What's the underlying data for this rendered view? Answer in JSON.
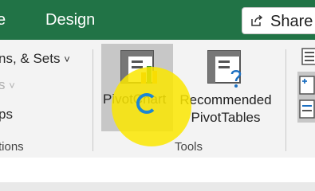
{
  "tabs": {
    "analyze_partial": "ze",
    "design": "Design"
  },
  "share": {
    "label": "Share"
  },
  "filter_group": {
    "line1": "ns, & Sets",
    "line1_chevron": "˅",
    "line2": "s",
    "line2_chevron": "˅",
    "line3": "ps",
    "label": "tions"
  },
  "tools_group": {
    "pivotchart_label": "PivotChart",
    "recommended_line1": "Recommended",
    "recommended_line2": "PivotTables",
    "label": "Tools"
  },
  "colors": {
    "accent": "#217346",
    "highlight": "#fae600",
    "cursor_ring": "#1c86d4"
  }
}
